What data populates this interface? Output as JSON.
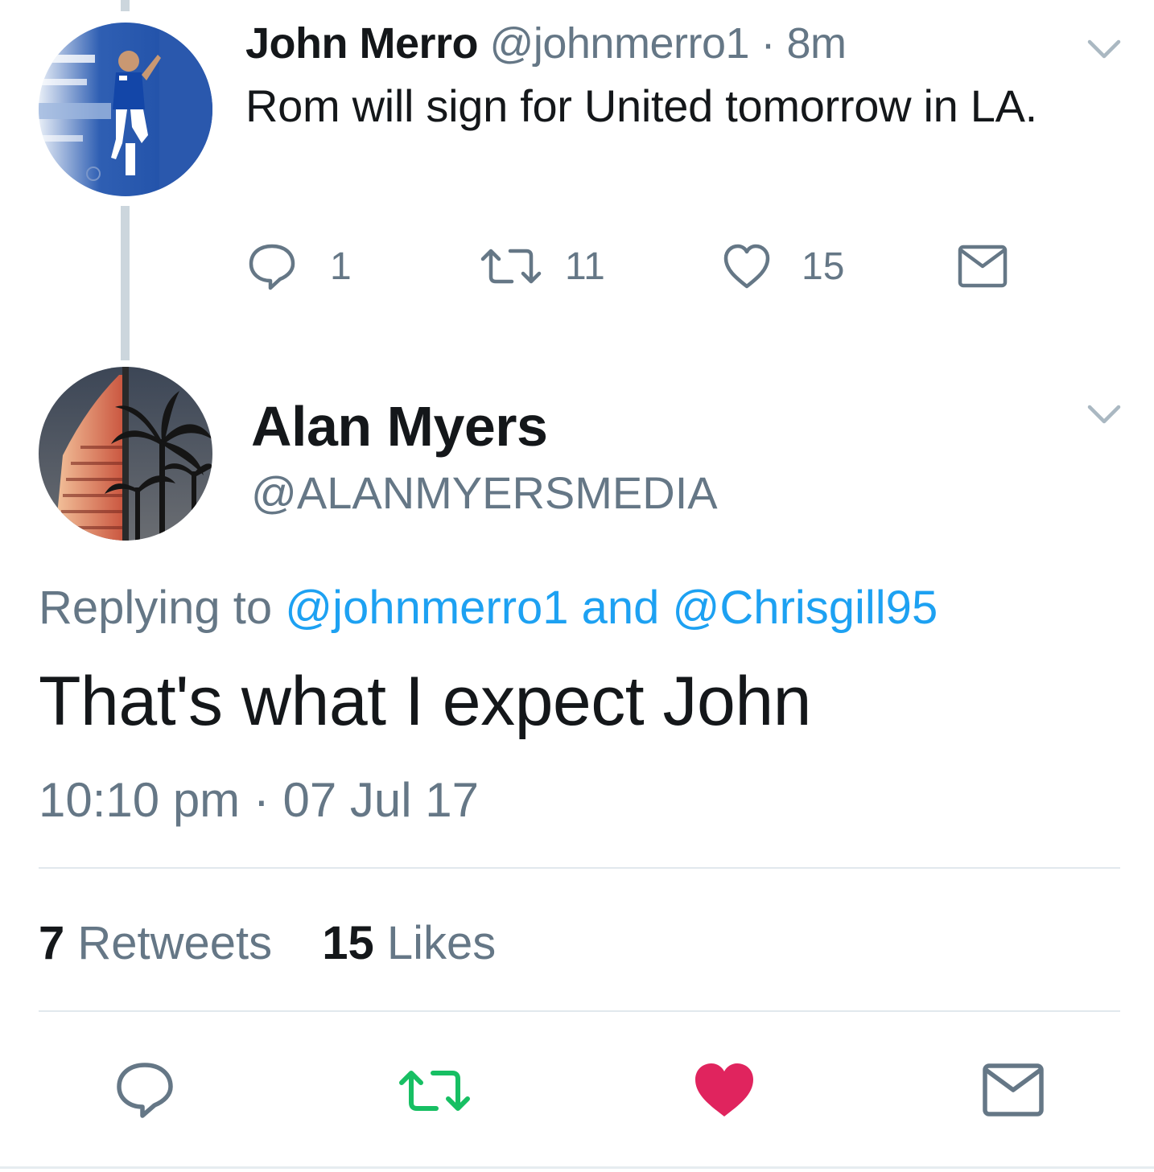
{
  "parent_tweet": {
    "author_name": "John Merro",
    "author_handle": "@johnmerro1",
    "separator": " · ",
    "time_ago": "8m",
    "text": "Rom will sign for United tomorrow in LA.",
    "reply_count": "1",
    "retweet_count": "11",
    "like_count": "15"
  },
  "main_tweet": {
    "author_name": "Alan Myers",
    "author_handle": "@ALANMYERSMEDIA",
    "replying_prefix": "Replying to ",
    "replying_to_1": "@johnmerro1",
    "replying_and": " and ",
    "replying_to_2": "@Chrisgill95",
    "text": "That's what I expect John",
    "time": "10:10 pm",
    "date_separator": " · ",
    "date": "07 Jul 17",
    "retweets_count": "7",
    "retweets_label": " Retweets",
    "likes_count": "15",
    "likes_label": " Likes"
  },
  "icons": {
    "reply": "speech-bubble-icon",
    "retweet": "retweet-arrows-icon",
    "like": "heart-icon",
    "share": "envelope-icon",
    "more": "chevron-down-icon"
  },
  "colors": {
    "text_primary": "#14171a",
    "text_secondary": "#657786",
    "link": "#1da1f2",
    "retweet_active": "#17bf63",
    "like_active": "#e0245e",
    "divider": "#e1e8ed"
  }
}
